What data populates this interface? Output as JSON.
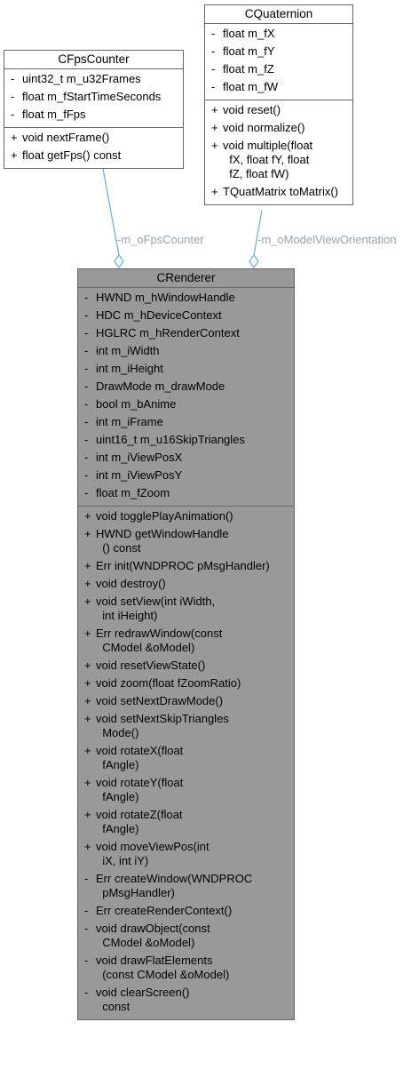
{
  "connectors": {
    "fps_counter_label": "-m_oFpsCounter",
    "orientation_label": "-m_oModelViewOrientation",
    "line_color": "#5fb0e0",
    "label_color": "#9aa3ab"
  },
  "colors": {
    "main_fill": "#999999",
    "box_fill": "#ffffff",
    "border": "#666666"
  },
  "boxes": {
    "quaternion": {
      "title": "CQuaternion",
      "attributes": [
        {
          "vis": "-",
          "text": "float m_fX"
        },
        {
          "vis": "-",
          "text": "float m_fY"
        },
        {
          "vis": "-",
          "text": "float m_fZ"
        },
        {
          "vis": "-",
          "text": "float m_fW"
        }
      ],
      "operations": [
        {
          "vis": "+",
          "text": "void reset()"
        },
        {
          "vis": "+",
          "text": "void normalize()"
        },
        {
          "vis": "+",
          "text": "void multiple(float\n  fX, float fY, float\n  fZ, float fW)"
        },
        {
          "vis": "+",
          "text": "TQuatMatrix toMatrix()"
        }
      ]
    },
    "fps": {
      "title": "CFpsCounter",
      "attributes": [
        {
          "vis": "-",
          "text": "uint32_t m_u32Frames"
        },
        {
          "vis": "-",
          "text": "float m_fStartTimeSeconds"
        },
        {
          "vis": "-",
          "text": "float m_fFps"
        }
      ],
      "operations": [
        {
          "vis": "+",
          "text": "void nextFrame()"
        },
        {
          "vis": "+",
          "text": "float getFps() const"
        }
      ]
    },
    "renderer": {
      "title": "CRenderer",
      "attributes": [
        {
          "vis": "-",
          "text": "HWND m_hWindowHandle"
        },
        {
          "vis": "-",
          "text": "HDC m_hDeviceContext"
        },
        {
          "vis": "-",
          "text": "HGLRC m_hRenderContext"
        },
        {
          "vis": "-",
          "text": "int m_iWidth"
        },
        {
          "vis": "-",
          "text": "int m_iHeight"
        },
        {
          "vis": "-",
          "text": "DrawMode m_drawMode"
        },
        {
          "vis": "-",
          "text": "bool m_bAnime"
        },
        {
          "vis": "-",
          "text": "int m_iFrame"
        },
        {
          "vis": "-",
          "text": "uint16_t m_u16SkipTriangles"
        },
        {
          "vis": "-",
          "text": "int m_iViewPosX"
        },
        {
          "vis": "-",
          "text": "int m_iViewPosY"
        },
        {
          "vis": "-",
          "text": "float m_fZoom"
        }
      ],
      "operations": [
        {
          "vis": "+",
          "text": "void togglePlayAnimation()"
        },
        {
          "vis": "+",
          "text": "HWND getWindowHandle\n  () const"
        },
        {
          "vis": "+",
          "text": "Err init(WNDPROC pMsgHandler)"
        },
        {
          "vis": "+",
          "text": "void destroy()"
        },
        {
          "vis": "+",
          "text": "void setView(int iWidth,\n  int iHeight)"
        },
        {
          "vis": "+",
          "text": "Err redrawWindow(const\n  CModel &oModel)"
        },
        {
          "vis": "+",
          "text": "void resetViewState()"
        },
        {
          "vis": "+",
          "text": "void zoom(float fZoomRatio)"
        },
        {
          "vis": "+",
          "text": "void setNextDrawMode()"
        },
        {
          "vis": "+",
          "text": "void setNextSkipTriangles\n  Mode()"
        },
        {
          "vis": "+",
          "text": "void rotateX(float\n  fAngle)"
        },
        {
          "vis": "+",
          "text": "void rotateY(float\n  fAngle)"
        },
        {
          "vis": "+",
          "text": "void rotateZ(float\n  fAngle)"
        },
        {
          "vis": "+",
          "text": "void moveViewPos(int\n  iX, int iY)"
        },
        {
          "vis": "-",
          "text": "Err createWindow(WNDPROC\n  pMsgHandler)"
        },
        {
          "vis": "-",
          "text": "Err createRenderContext()"
        },
        {
          "vis": "-",
          "text": "void drawObject(const\n  CModel &oModel)"
        },
        {
          "vis": "-",
          "text": "void drawFlatElements\n  (const CModel &oModel)"
        },
        {
          "vis": "-",
          "text": "void clearScreen()\n  const"
        }
      ]
    }
  }
}
